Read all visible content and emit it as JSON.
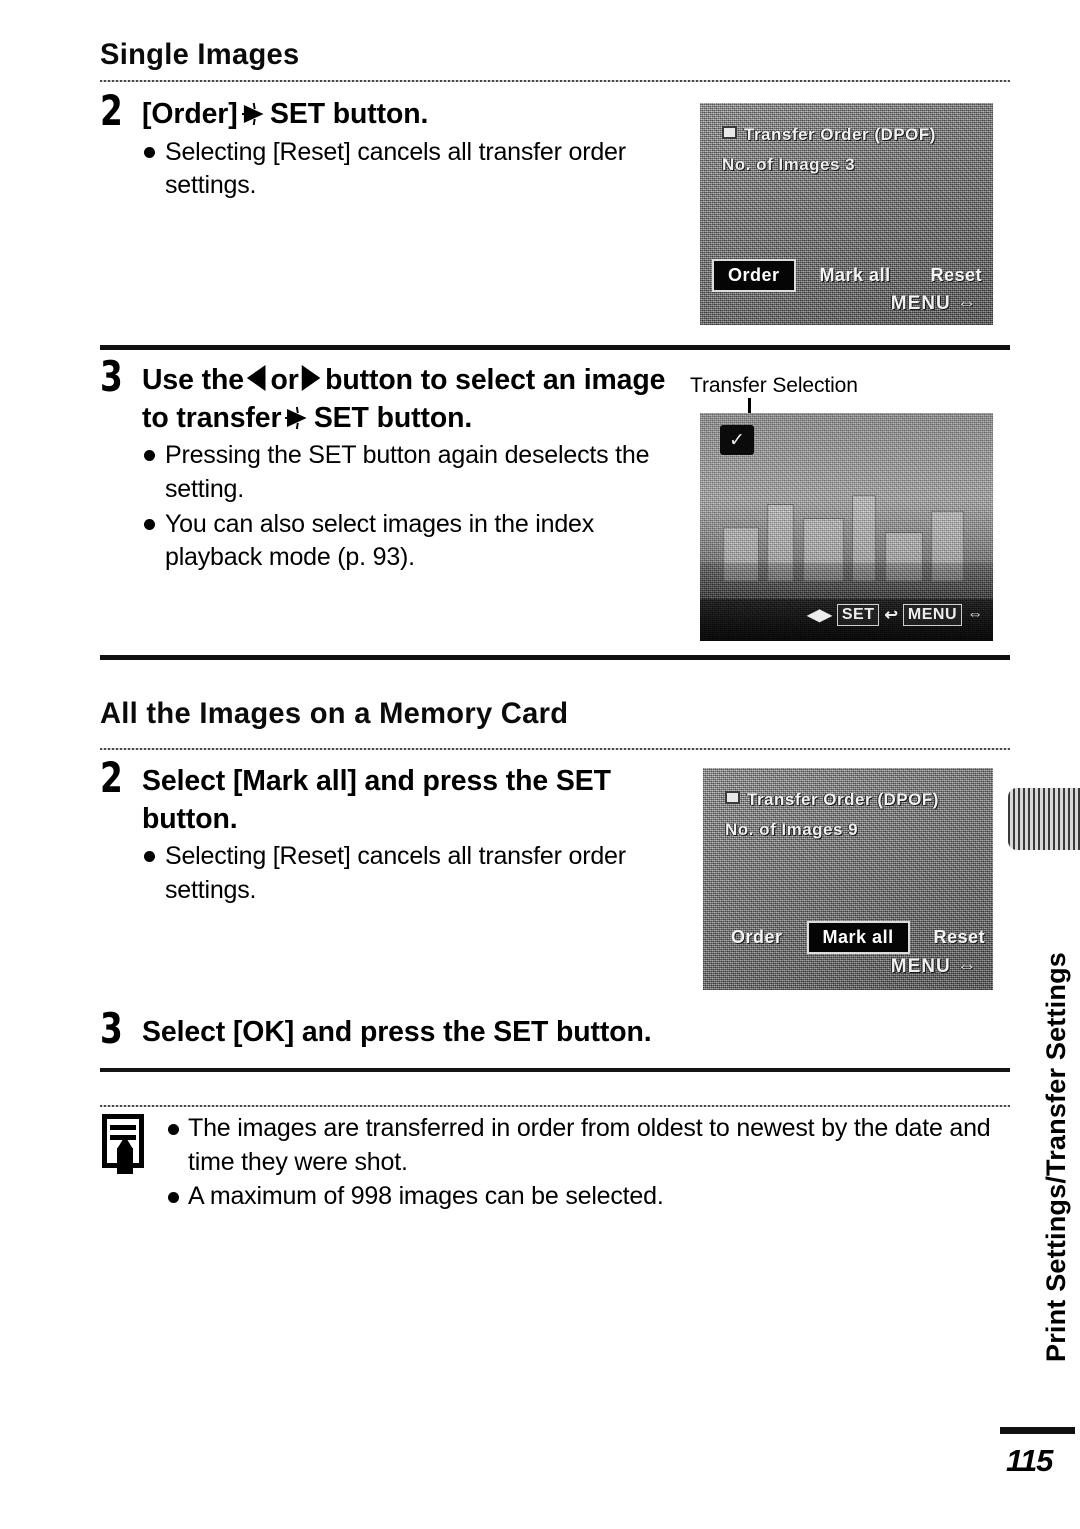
{
  "page": {
    "number": "115",
    "side_tab_label": "Print Settings/Transfer Settings"
  },
  "sections": [
    {
      "heading": "Single Images",
      "steps": [
        {
          "number": "2",
          "title_parts": {
            "before": "[Order]",
            "arrow_icon": "set-burst-arrow-icon",
            "after": "SET button."
          },
          "bullets": [
            "Selecting [Reset] cancels all transfer order settings."
          ],
          "lcd": {
            "name": "transfer-order-menu-order-selected",
            "title": "Transfer Order (DPOF)",
            "subtitle": "No. of Images  3",
            "buttons": [
              {
                "label": "Order",
                "selected": true
              },
              {
                "label": "Mark all",
                "selected": false
              },
              {
                "label": "Reset",
                "selected": false
              }
            ],
            "menu_tag": "MENU"
          }
        },
        {
          "number": "3",
          "title_parts": {
            "before": "Use the",
            "left_arrow_icon": "left-arrow-icon",
            "or": "or",
            "right_arrow_icon": "right-arrow-icon",
            "middle": "button to select an image to transfer",
            "arrow_icon": "set-burst-arrow-icon",
            "after": "SET button."
          },
          "bullets": [
            "Pressing the SET button again deselects the setting.",
            "You can also select images in the index playback mode (p. 93)."
          ],
          "caption": "Transfer Selection",
          "lcd": {
            "name": "transfer-selection-preview",
            "check_icon": "checkmark-icon",
            "status_items": [
              {
                "type": "glyph",
                "label": "◀▶"
              },
              {
                "type": "chip",
                "label": "SET"
              },
              {
                "type": "glyph",
                "label": "↩"
              },
              {
                "type": "chip",
                "label": "MENU"
              },
              {
                "type": "glyph",
                "label": "⇔"
              }
            ]
          }
        }
      ]
    },
    {
      "heading": "All the Images on a Memory Card",
      "steps": [
        {
          "number": "2",
          "title_parts": {
            "before": "Select [Mark all] and press the",
            "after": "SET button."
          },
          "bullets": [
            "Selecting [Reset] cancels all transfer order settings."
          ],
          "lcd": {
            "name": "transfer-order-menu-mark-all-selected",
            "title": "Transfer Order (DPOF)",
            "subtitle": "No. of Images  9",
            "buttons": [
              {
                "label": "Order",
                "selected": false
              },
              {
                "label": "Mark all",
                "selected": true
              },
              {
                "label": "Reset",
                "selected": false
              }
            ],
            "menu_tag": "MENU"
          }
        },
        {
          "number": "3",
          "title_parts": {
            "before": "Select [OK] and press the",
            "after": "SET button."
          },
          "bullets": []
        }
      ]
    }
  ],
  "note": {
    "icon": "memo-pencil-icon",
    "bullets": [
      "The images are transferred in order from oldest to newest by the date and time they were shot.",
      "A maximum of 998 images can be selected."
    ]
  }
}
